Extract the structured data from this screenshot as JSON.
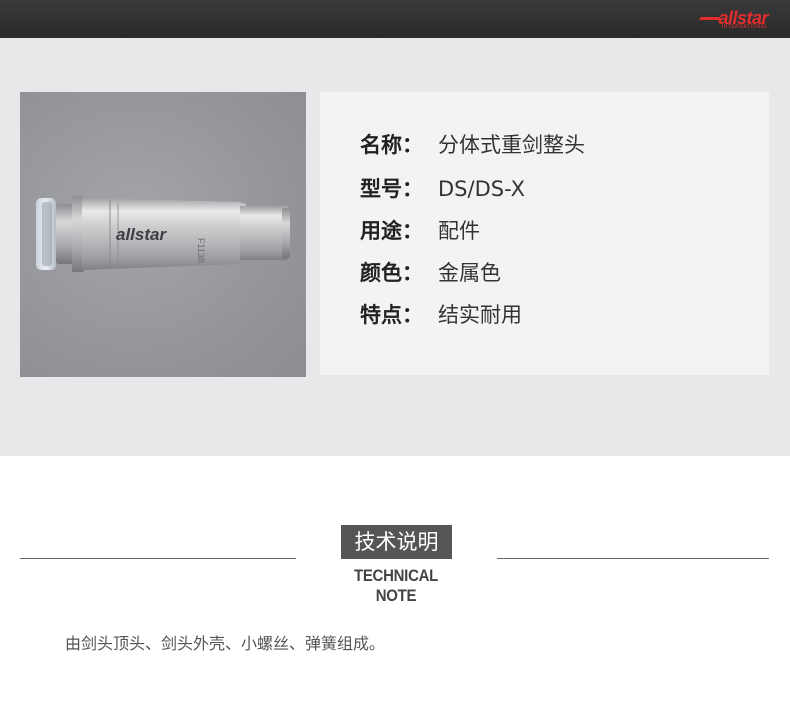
{
  "header": {
    "brand_name": "allstar",
    "brand_sub": "INTERNATIONAL",
    "brand_color": "#e32d2d"
  },
  "product": {
    "image_label": "allstar",
    "image_code": "F1138",
    "specs": [
      {
        "key": "名称：",
        "value": "分体式重剑整头"
      },
      {
        "key": "型号：",
        "value": "DS/DS-X"
      },
      {
        "key": "用途：",
        "value": "配件"
      },
      {
        "key": "颜色：",
        "value": "金属色"
      },
      {
        "key": "特点：",
        "value": "结实耐用"
      }
    ]
  },
  "technical": {
    "title": "技术说明",
    "subtitle": "TECHNICAL NOTE",
    "description": "由剑头顶头、剑头外壳、小螺丝、弹簧组成。"
  }
}
